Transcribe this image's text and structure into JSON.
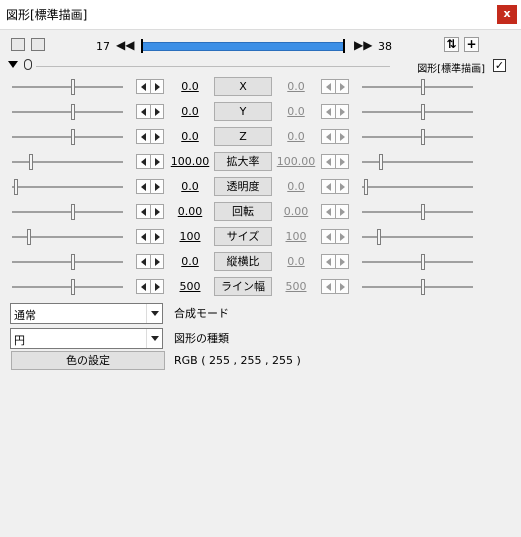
{
  "window": {
    "title": "図形[標準描画]",
    "close_label": "x"
  },
  "toolbar": {
    "start_frame": "17",
    "end_frame": "38",
    "timeline_progress": 1.0,
    "prev_icon": "rewind-icon",
    "next_icon": "fast-forward-icon",
    "left_icons": [
      "camera-control-icon",
      "frame-select-icon"
    ],
    "right_icons": [
      "sync-icon",
      "add-filter-icon"
    ]
  },
  "object": {
    "name": "図形[標準描画]",
    "enabled": true,
    "checkmark": "✓"
  },
  "params": [
    {
      "label": "X",
      "start": "0.0",
      "end": "0.0",
      "start_pos": 0.55,
      "end_pos": 0.55
    },
    {
      "label": "Y",
      "start": "0.0",
      "end": "0.0",
      "start_pos": 0.55,
      "end_pos": 0.55
    },
    {
      "label": "Z",
      "start": "0.0",
      "end": "0.0",
      "start_pos": 0.55,
      "end_pos": 0.55
    },
    {
      "label": "拡大率",
      "start": "100.00",
      "end": "100.00",
      "start_pos": 0.17,
      "end_pos": 0.17
    },
    {
      "label": "透明度",
      "start": "0.0",
      "end": "0.0",
      "start_pos": 0.04,
      "end_pos": 0.04
    },
    {
      "label": "回転",
      "start": "0.00",
      "end": "0.00",
      "start_pos": 0.55,
      "end_pos": 0.55
    },
    {
      "label": "サイズ",
      "start": "100",
      "end": "100",
      "start_pos": 0.15,
      "end_pos": 0.15
    },
    {
      "label": "縦横比",
      "start": "0.0",
      "end": "0.0",
      "start_pos": 0.55,
      "end_pos": 0.55
    },
    {
      "label": "ライン幅",
      "start": "500",
      "end": "500",
      "start_pos": 0.55,
      "end_pos": 0.55
    }
  ],
  "blend": {
    "value": "通常",
    "label": "合成モード"
  },
  "shape": {
    "value": "円",
    "label": "図形の種類"
  },
  "color": {
    "button_label": "色の設定",
    "rgb_text": "RGB ( 255 , 255 , 255 )"
  }
}
